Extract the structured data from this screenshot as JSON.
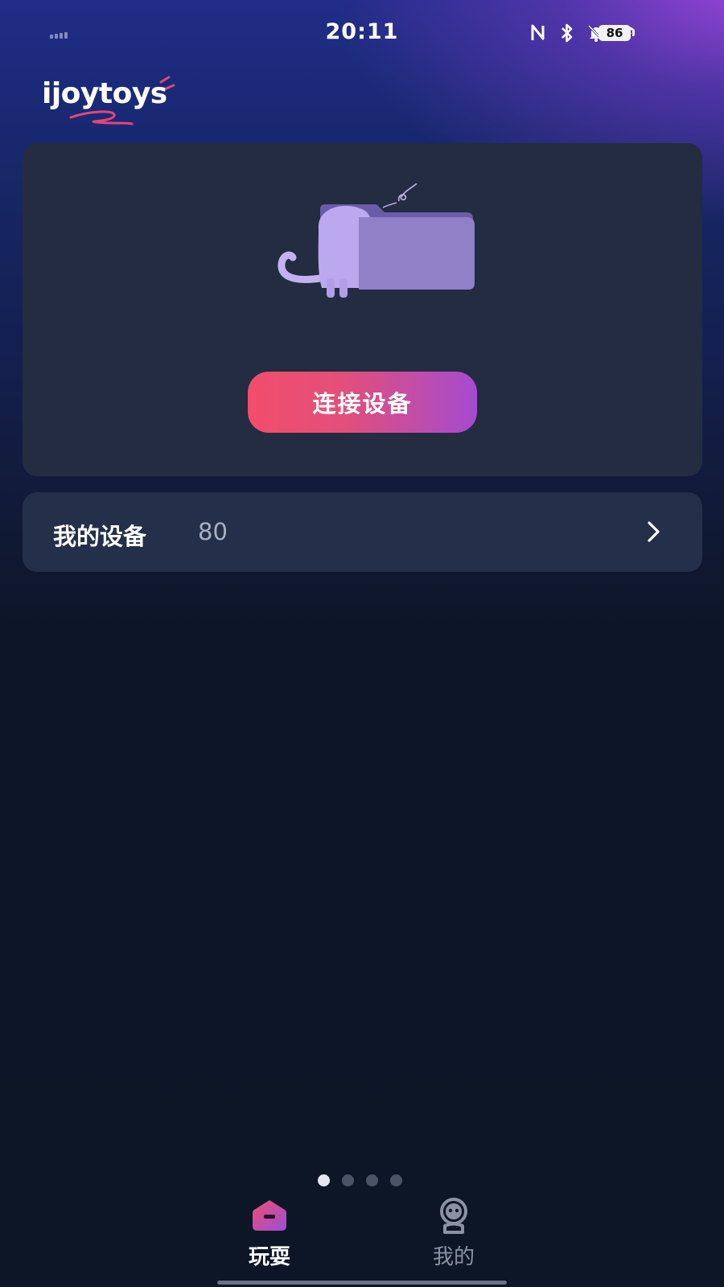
{
  "status_bar": {
    "time": "20:11",
    "battery": "86",
    "icons": [
      "signal-icon",
      "nfc-icon",
      "bluetooth-icon",
      "mute-bell-icon",
      "wifi-icon",
      "battery-icon"
    ]
  },
  "brand": {
    "logo_text": "ijoytoys",
    "accent_color": "#e2467a",
    "secondary_color": "#a54bd0"
  },
  "hero": {
    "illustration": "cat-folder-illustration",
    "connect_button_label": "连接设备"
  },
  "devices": {
    "label": "我的设备",
    "count": "80",
    "chevron": "chevron-right-icon"
  },
  "pager": {
    "total": 4,
    "active_index": 0
  },
  "bottom_nav": {
    "items": [
      {
        "label": "玩耍",
        "icon": "play-home-icon",
        "active": true
      },
      {
        "label": "我的",
        "icon": "robot-profile-icon",
        "active": false
      }
    ]
  }
}
